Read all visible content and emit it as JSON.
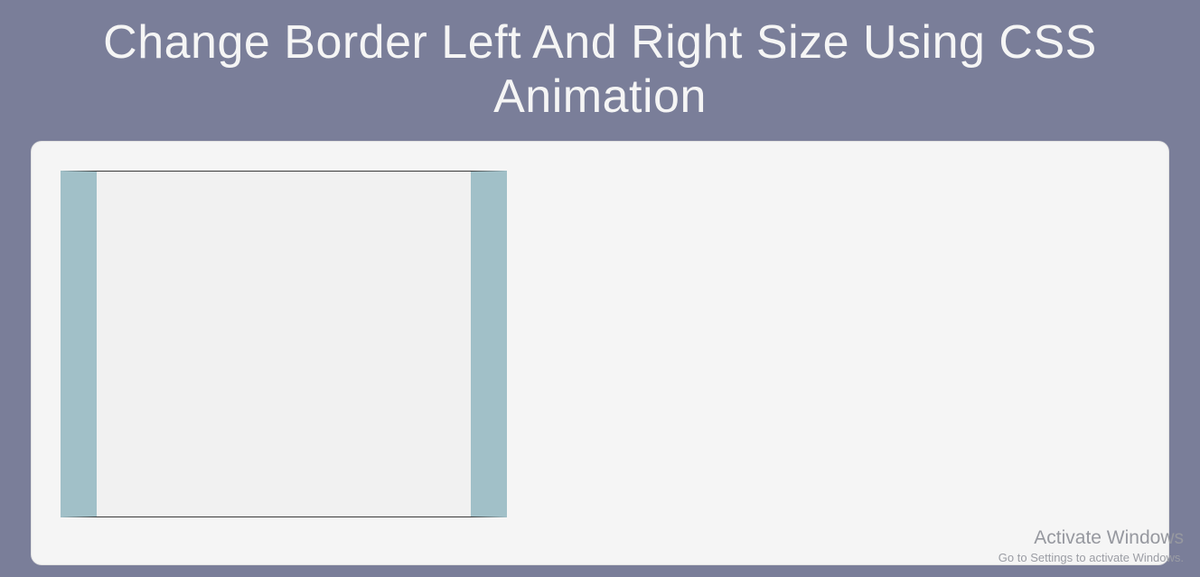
{
  "title": "Change Border Left And Right Size Using CSS Animation",
  "watermark": {
    "title": "Activate Windows",
    "subtitle": "Go to Settings to activate Windows."
  }
}
